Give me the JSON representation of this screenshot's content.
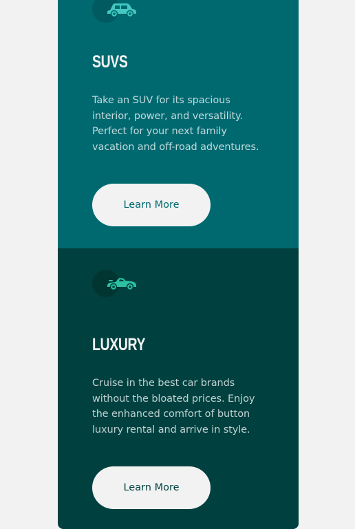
{
  "cards": [
    {
      "icon": "suv-icon",
      "title": "SUVS",
      "description": "Take an SUV for its spacious interior, power, and versatility. Perfect for your next family vacation and off-road adventures.",
      "button_label": "Learn More",
      "background": "#006970",
      "icon_color": "#44c8c0"
    },
    {
      "icon": "luxury-car-icon",
      "title": "LUXURY",
      "description": "Cruise in the best car brands without the bloated prices. Enjoy the enhanced comfort of button luxury rental and arrive in style.",
      "button_label": "Learn More",
      "background": "#004140",
      "icon_color": "#2ec1a1"
    }
  ],
  "colors": {
    "page_background": "#f2f2f2",
    "button_background": "#f2f2f2"
  }
}
